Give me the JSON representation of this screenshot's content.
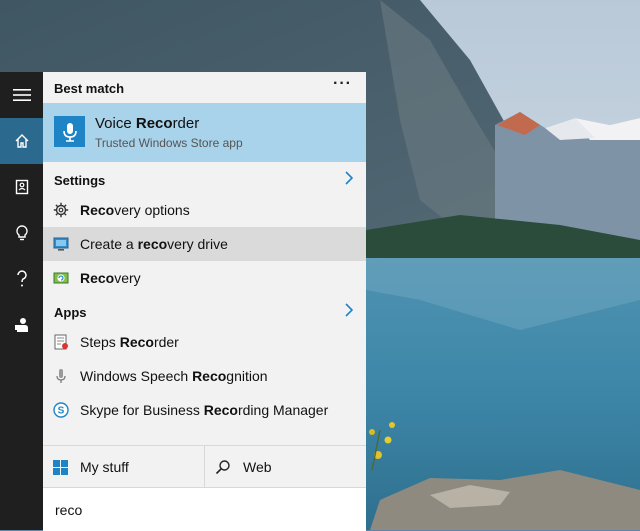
{
  "start_rail": {
    "items": [
      "menu",
      "home",
      "notebook",
      "ideas",
      "help",
      "feedback"
    ]
  },
  "best_match": {
    "header": "Best match",
    "more_label": "···",
    "app": {
      "title_pre": "Voice ",
      "title_match": "Reco",
      "title_post": "rder",
      "subtitle": "Trusted Windows Store app"
    }
  },
  "settings": {
    "header": "Settings",
    "items": [
      {
        "pre": "",
        "match": "Reco",
        "post": "very options",
        "icon": "gear-icon"
      },
      {
        "pre": "Create a ",
        "match": "reco",
        "post": "very drive",
        "icon": "monitor-icon"
      },
      {
        "pre": "",
        "match": "Reco",
        "post": "very",
        "icon": "recovery-icon"
      }
    ]
  },
  "apps": {
    "header": "Apps",
    "items": [
      {
        "pre": "Steps ",
        "match": "Reco",
        "post": "rder",
        "icon": "steps-recorder-icon"
      },
      {
        "pre": "Windows Speech ",
        "match": "Reco",
        "post": "gnition",
        "icon": "microphone-icon"
      },
      {
        "pre": "Skype for Business ",
        "match": "Reco",
        "post": "rding Manager",
        "icon": "skype-icon"
      }
    ]
  },
  "bottom": {
    "my_stuff": "My stuff",
    "web": "Web"
  },
  "search": {
    "value": "reco"
  },
  "colors": {
    "rail_bg": "#1f1f1f",
    "rail_active": "#2b6a8e",
    "panel_bg": "#f2f2f2",
    "best_match_bg": "#a9d3ea",
    "hover_bg": "#dadada",
    "accent": "#1e84c6"
  }
}
